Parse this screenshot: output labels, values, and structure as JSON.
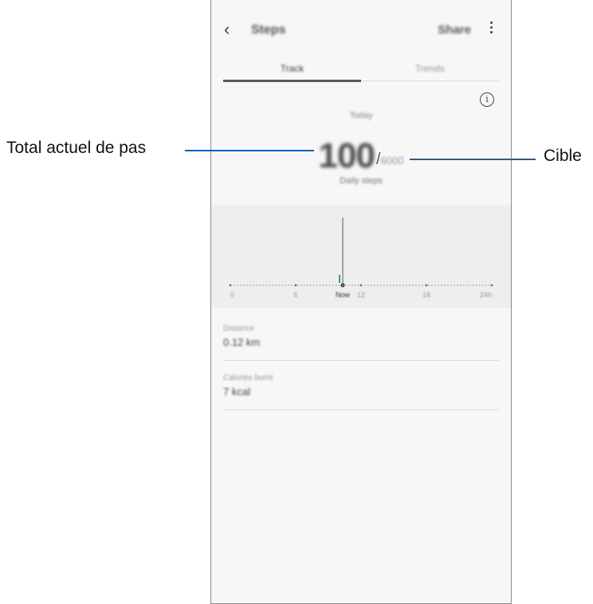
{
  "app": {
    "title": "Steps",
    "share_label": "Share",
    "back_icon": "chevron-left-icon",
    "more_icon": "more-vertical-icon"
  },
  "tabs": [
    {
      "label": "Track",
      "active": true
    },
    {
      "label": "Trends",
      "active": false
    }
  ],
  "summary": {
    "info_icon": "info-icon",
    "day_label": "Today",
    "steps": "100",
    "slash": "/",
    "goal": "6000",
    "caption": "Daily steps"
  },
  "chart_data": {
    "type": "bar",
    "x_ticks": [
      "0",
      "6",
      "Now",
      "12",
      "18",
      "24h"
    ],
    "current_label": "Now",
    "bar_colors": {
      "steps": "#2eae4f",
      "now_marker": "#333333"
    }
  },
  "stats": [
    {
      "label": "Distance",
      "value": "0.12 km"
    },
    {
      "label": "Calories burnt",
      "value": "7 kcal"
    }
  ],
  "callouts": {
    "left": "Total actuel de pas",
    "right": "Cible",
    "line_color": "#1c5fa6"
  }
}
